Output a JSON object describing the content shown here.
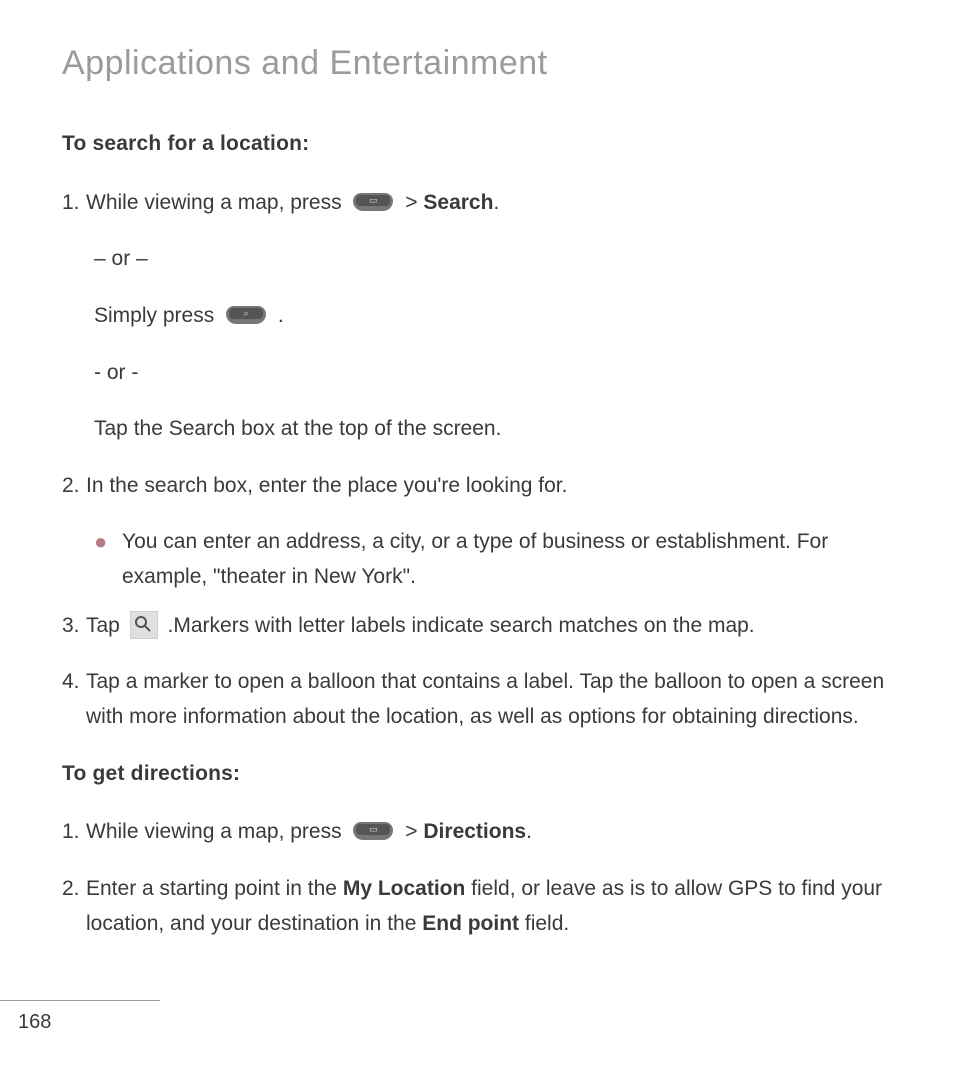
{
  "page_title": "Applications and Entertainment",
  "section1_heading": "To search for a location:",
  "s1_step1_a": "While viewing a map, press ",
  "s1_step1_b": " > ",
  "s1_step1_c": "Search",
  "s1_step1_d": ".",
  "s1_or1": "– or –",
  "s1_simply": "Simply press ",
  "s1_simply_end": " .",
  "s1_or2": "- or -",
  "s1_tap_search_box": "Tap the Search box at the top of the screen.",
  "s1_step2": "In the search box, enter the place you're looking for.",
  "s1_bullet": "You can enter an address, a city, or a type of business or establishment. For example, \"theater in New York\".",
  "s1_step3_a": "Tap ",
  "s1_step3_b": " .Markers with letter labels indicate search matches on the map.",
  "s1_step4": "Tap a marker to open a balloon that contains a label. Tap the balloon to open a screen with more information about the location, as well as options for obtaining directions.",
  "section2_heading": "To get directions:",
  "s2_step1_a": "While viewing a map, press ",
  "s2_step1_b": " > ",
  "s2_step1_c": "Directions",
  "s2_step1_d": ".",
  "s2_step2_a": "Enter a starting point in the ",
  "s2_step2_b": "My Location",
  "s2_step2_c": " field, or leave as is to allow GPS to find your location, and your destination in the ",
  "s2_step2_d": "End point",
  "s2_step2_e": " field.",
  "page_number": "168",
  "nums": {
    "n1": "1.",
    "n2": "2.",
    "n3": "3.",
    "n4": "4."
  }
}
